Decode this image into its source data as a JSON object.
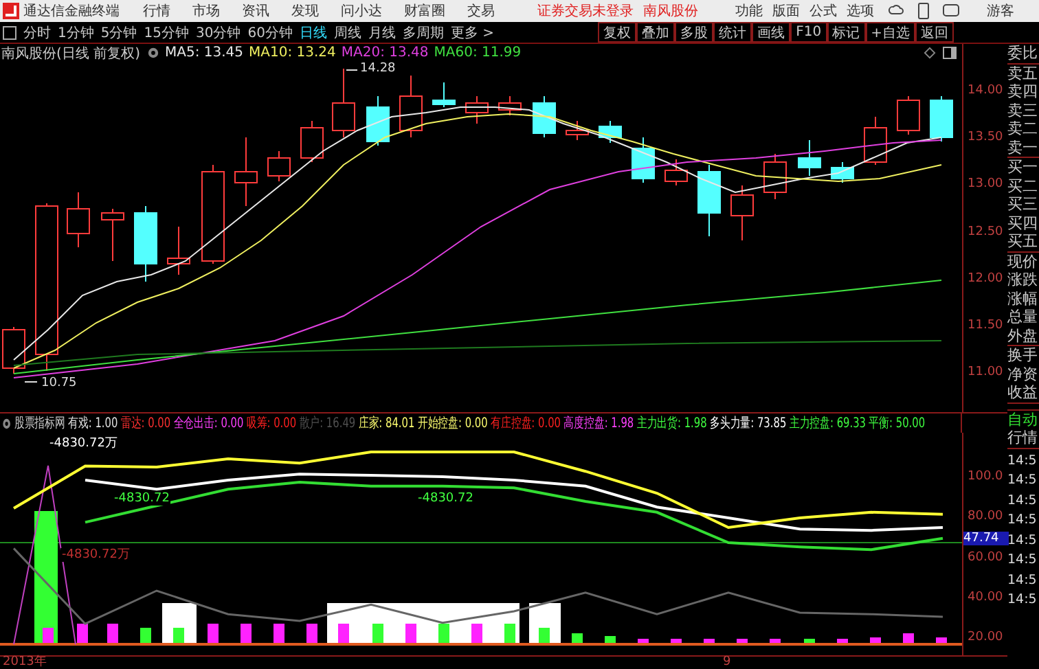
{
  "app": {
    "title": "通达信金融终端",
    "menu": [
      "行情",
      "市场",
      "资讯",
      "发现",
      "问小达",
      "财富圈",
      "交易"
    ],
    "notice": "证券交易未登录",
    "stock_link": "南风股份",
    "right_menu": [
      "功能",
      "版面",
      "公式",
      "选项"
    ],
    "user": "游客"
  },
  "periods": [
    {
      "label": "分时",
      "selected": false
    },
    {
      "label": "1分钟",
      "selected": false
    },
    {
      "label": "5分钟",
      "selected": false
    },
    {
      "label": "15分钟",
      "selected": false
    },
    {
      "label": "30分钟",
      "selected": false
    },
    {
      "label": "60分钟",
      "selected": false
    },
    {
      "label": "日线",
      "selected": true
    },
    {
      "label": "周线",
      "selected": false
    },
    {
      "label": "月线",
      "selected": false
    },
    {
      "label": "多周期",
      "selected": false
    },
    {
      "label": "更多 >",
      "selected": false
    }
  ],
  "tools": [
    "复权",
    "叠加",
    "多股",
    "统计",
    "画线",
    "F10",
    "标记",
    "+自选",
    "返回"
  ],
  "main_chart": {
    "title": "南风股份(日线 前复权)",
    "mas": [
      {
        "label": "MA5: 13.45",
        "color": "#e8e8e8"
      },
      {
        "label": "MA10: 13.24",
        "color": "#f0f060"
      },
      {
        "label": "MA20: 13.48",
        "color": "#e040e0"
      },
      {
        "label": "MA60: 11.99",
        "color": "#40e040"
      }
    ],
    "high_label": "14.28",
    "low_label": "10.75",
    "price_ticks": [
      "14.00",
      "13.50",
      "13.00",
      "12.50",
      "12.00",
      "11.50",
      "11.00"
    ]
  },
  "indicator": {
    "name": "股票指标网",
    "fields": [
      {
        "text": "有戏: 1.00",
        "color": "#e0e0e0"
      },
      {
        "text": "雷达: 0.00",
        "color": "#ff3030"
      },
      {
        "text": "全仓出击: 0.00",
        "color": "#ff40ff"
      },
      {
        "text": "吸筹: 0.00",
        "color": "#ff2020"
      },
      {
        "text": "散户: 16.49",
        "color": "#505050"
      },
      {
        "text": "庄家: 84.01",
        "color": "#ffff70"
      },
      {
        "text": "开始控盘: 0.00",
        "color": "#ffff70"
      },
      {
        "text": "有庄控盘: 0.00",
        "color": "#ff2020"
      },
      {
        "text": "高度控盘: 1.98",
        "color": "#ff40ff"
      },
      {
        "text": "主力出货: 1.98",
        "color": "#40ff40"
      },
      {
        "text": "多头力量: 73.85",
        "color": "#ffffff"
      },
      {
        "text": "主力控盘: 69.33",
        "color": "#40ff40"
      },
      {
        "text": "平衡: 50.00",
        "color": "#40ff40"
      }
    ],
    "value_labels": [
      {
        "text": "-4830.72万",
        "color": "#ffffff"
      },
      {
        "text": "-4830.72",
        "color": "#40ff40"
      },
      {
        "text": "-4830.72",
        "color": "#40ff40"
      },
      {
        "text": "-4830.72万",
        "color": "#c03030"
      }
    ],
    "current_value": "47.74",
    "chart_data": {
      "type": "line",
      "ylim": [
        17.3,
        122.6
      ],
      "yticks": [
        {
          "value": 100,
          "label": "100.0"
        },
        {
          "value": 80,
          "label": "80.00"
        },
        {
          "value": 60,
          "label": "60.00"
        },
        {
          "value": 40,
          "label": "40.00"
        },
        {
          "value": 20,
          "label": "20.00"
        }
      ],
      "series": [
        {
          "color": "#666666",
          "values": [
            65,
            27.5,
            44,
            32.3,
            28.9,
            37,
            28,
            33.7,
            43,
            32.3,
            43,
            33,
            32.3,
            31
          ]
        },
        {
          "color": "#33dd33",
          "values": [
            null,
            78,
            86.3,
            94.5,
            98,
            96,
            96,
            95.2,
            88.4,
            83,
            67.9,
            65.8,
            64.4,
            70
          ]
        },
        {
          "color": "#ffffff",
          "values": [
            null,
            99,
            94.5,
            99,
            102,
            101.4,
            100.7,
            99,
            96,
            85.6,
            80.2,
            74.7,
            74,
            75.4
          ]
        },
        {
          "color": "#ffff33",
          "values": [
            85,
            106,
            105.5,
            109.6,
            107.5,
            113,
            113,
            113,
            103.4,
            92.5,
            75.4,
            80.2,
            83,
            82
          ]
        }
      ]
    }
  },
  "dates": [
    "2013年",
    "9"
  ],
  "side_panel": {
    "groups": [
      [
        "委比"
      ],
      [
        "卖五",
        "卖四",
        "卖三",
        "卖二",
        "卖一"
      ],
      [
        "买一",
        "买二",
        "买三",
        "买四",
        "买五"
      ],
      [
        "现价",
        "涨跌",
        "涨幅",
        "总量",
        "外盘"
      ],
      [
        "换手",
        "净资",
        "收益"
      ]
    ],
    "mode": "自动",
    "title": "行情",
    "times": [
      "14:5",
      "14:5",
      "14:5",
      "14:5",
      "14:5",
      "14:5",
      "14:5",
      "14:5"
    ]
  }
}
